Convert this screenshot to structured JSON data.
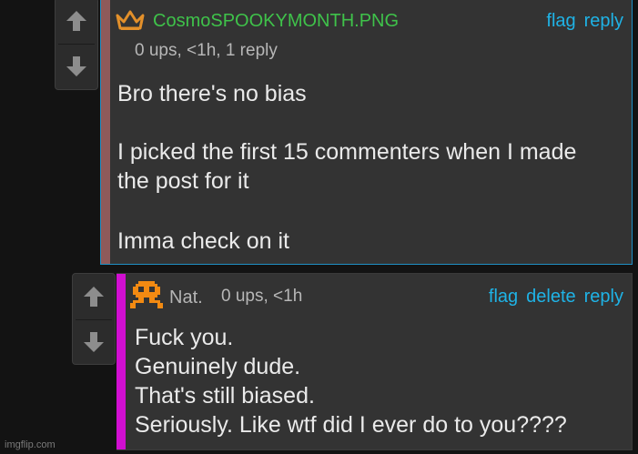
{
  "comment1": {
    "username": "CosmoSPOOKYMONTH.PNG",
    "username_color": "#3fc24a",
    "meta": "0 ups, <1h, 1 reply",
    "actions": {
      "flag": "flag",
      "reply": "reply"
    },
    "stripe_color": "#8e5a5a",
    "body": {
      "line1": "Bro there's no bias",
      "line2": "I picked the first 15 commenters when I made",
      "line3": "the post for it",
      "line4": "Imma check on it"
    },
    "badge_icon": "crown-icon"
  },
  "comment2": {
    "username": "Nat.",
    "username_color": "#b5b5b5",
    "meta": "0 ups, <1h",
    "actions": {
      "flag": "flag",
      "delete": "delete",
      "reply": "reply"
    },
    "stripe_color": "#d10fd1",
    "body": {
      "line1": "Fuck you.",
      "line2": "Genuinely dude.",
      "line3": "That's still biased.",
      "line4": "Seriously. Like wtf did I ever do to you????"
    },
    "avatar_icon": "pixel-sprite-icon"
  },
  "colors": {
    "link": "#1fb3e6",
    "background": "#131313",
    "panel": "#333333",
    "selected_border": "#1f8fc4"
  },
  "watermark": "imgflip.com"
}
